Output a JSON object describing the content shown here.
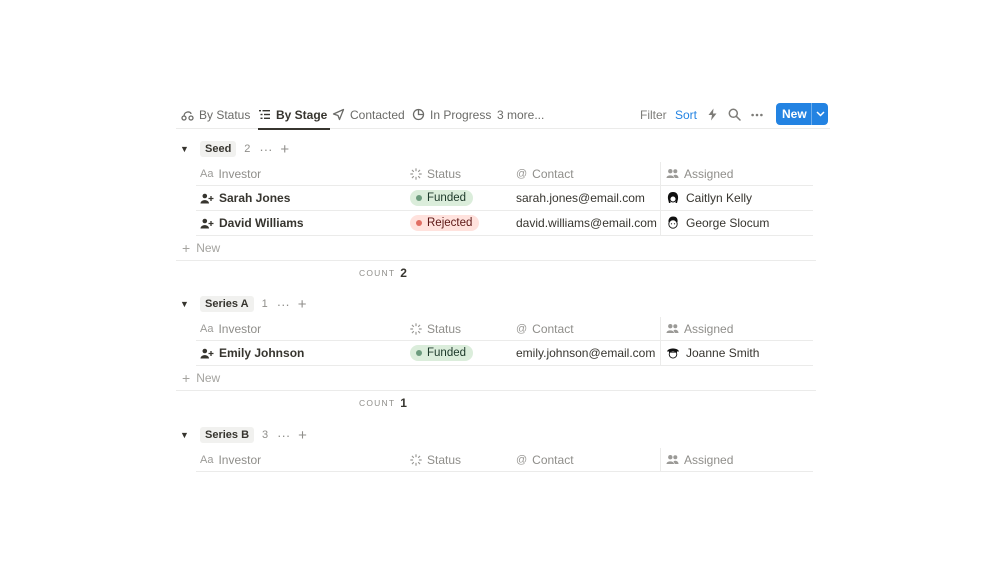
{
  "tabs": [
    {
      "label": "By Status",
      "icon": "status-icon",
      "active": false
    },
    {
      "label": "By Stage",
      "icon": "list-icon",
      "active": true
    },
    {
      "label": "Contacted",
      "icon": "send-icon",
      "active": false
    },
    {
      "label": "In Progress",
      "icon": "pie-icon",
      "active": false
    }
  ],
  "more_tabs": "3 more...",
  "toolbar": {
    "filter": "Filter",
    "sort": "Sort",
    "new_label": "New"
  },
  "colors": {
    "accent": "#2383e2",
    "funded_bg": "#dbeddb",
    "funded_dot": "#6c9b7d",
    "rejected_bg": "#ffe2dd",
    "rejected_dot": "#e16f64"
  },
  "columns": {
    "investor": "Investor",
    "status": "Status",
    "contact": "Contact",
    "assigned": "Assigned",
    "investor_prefix": "Aa"
  },
  "groups": [
    {
      "name": "Seed",
      "count": "2",
      "rows": [
        {
          "investor": "Sarah Jones",
          "status": "Funded",
          "contact": "sarah.jones@email.com",
          "assigned": "Caitlyn Kelly"
        },
        {
          "investor": "David Williams",
          "status": "Rejected",
          "contact": "david.williams@email.com",
          "assigned": "George Slocum"
        }
      ],
      "new_label": "New",
      "count_label": "COUNT",
      "count_value": "2"
    },
    {
      "name": "Series A",
      "count": "1",
      "rows": [
        {
          "investor": "Emily Johnson",
          "status": "Funded",
          "contact": "emily.johnson@email.com",
          "assigned": "Joanne Smith"
        }
      ],
      "new_label": "New",
      "count_label": "COUNT",
      "count_value": "1"
    },
    {
      "name": "Series B",
      "count": "3",
      "rows": []
    }
  ]
}
